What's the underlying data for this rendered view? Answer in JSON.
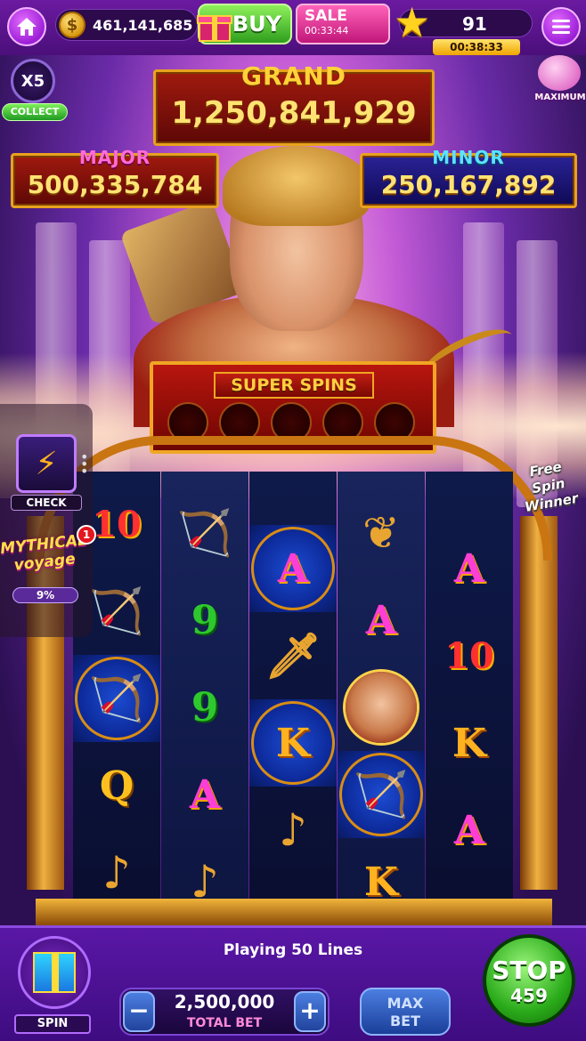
{
  "header": {
    "coins": "461,141,685",
    "buy_label": "BUY",
    "sale_label": "SALE",
    "sale_timer": "00:33:44",
    "level": "91",
    "level_timer": "00:38:33"
  },
  "side_left": {
    "multiplier": "X5",
    "collect_label": "COLLECT"
  },
  "piggy": {
    "label": "MAXIMUM"
  },
  "jackpots": {
    "grand": {
      "title": "GRAND",
      "value": "1,250,841,929"
    },
    "major": {
      "title": "MAJOR",
      "value": "500,335,784"
    },
    "minor": {
      "title": "MINOR",
      "value": "250,167,892"
    }
  },
  "super_spins": {
    "title": "SUPER SPINS",
    "slots_filled": 0,
    "slots_total": 5
  },
  "panel": {
    "check_label": "CHECK",
    "mythical_line1": "MYTHICAL",
    "mythical_line2": "voyage",
    "mythical_badge": "1",
    "mythical_progress": "9%"
  },
  "free_spin_badge": {
    "line1": "Free Spin",
    "line2": "Winner"
  },
  "reels": [
    [
      {
        "sym": "10"
      },
      {
        "sym": "bow"
      },
      {
        "sym": "bow",
        "hl": true
      },
      {
        "sym": "Q"
      },
      {
        "sym": "lyre"
      }
    ],
    [
      {
        "sym": "bow"
      },
      {
        "sym": "9"
      },
      {
        "sym": "9"
      },
      {
        "sym": "A"
      },
      {
        "sym": "lyre"
      }
    ],
    [
      {
        "sym": "A",
        "hl": true
      },
      {
        "sym": "sword"
      },
      {
        "sym": "K",
        "hl": true
      },
      {
        "sym": "lyre"
      },
      {
        "sym": "empty"
      }
    ],
    [
      {
        "sym": "wreath"
      },
      {
        "sym": "A"
      },
      {
        "sym": "apollo"
      },
      {
        "sym": "bow",
        "hl": true
      },
      {
        "sym": "K"
      }
    ],
    [
      {
        "sym": "A"
      },
      {
        "sym": "10"
      },
      {
        "sym": "K"
      },
      {
        "sym": "A"
      },
      {
        "sym": "empty"
      }
    ]
  ],
  "footer": {
    "playing_text": "Playing 50 Lines",
    "spin_label": "SPIN",
    "bet_value": "2,500,000",
    "bet_label": "TOTAL BET",
    "minus_label": "−",
    "plus_label": "+",
    "maxbet_line1": "MAX",
    "maxbet_line2": "BET",
    "stop_label": "STOP",
    "stop_count": "459"
  },
  "colors": {
    "accent_gold": "#f0a624",
    "grand_red": "#a11a0e",
    "jackpot_blue": "#2a2296",
    "bottom_purple": "#5a17a6",
    "stop_green": "#2aab1a"
  }
}
